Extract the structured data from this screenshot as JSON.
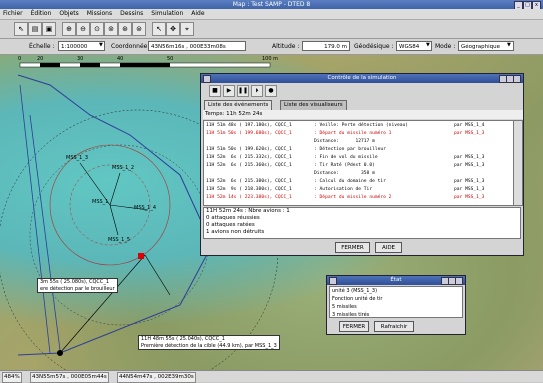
{
  "window": {
    "title": "Map : Test SAMP - DTED 8"
  },
  "menu": [
    "Fichier",
    "Édition",
    "Objets",
    "Missions",
    "Dessins",
    "Simulation",
    "Aide"
  ],
  "fields": {
    "echelle_label": "Échelle :",
    "echelle_value": "1:100000",
    "coord_label": "Coordonnée :",
    "coord_value": "43N56m16s , 000E33m08s",
    "altitude_label": "Altitude :",
    "altitude_value": "179.0 m",
    "geodesique_label": "Géodésique :",
    "geodesique_value": "WGS84",
    "mode_label": "Mode :",
    "mode_value": "Géographique"
  },
  "scale": {
    "ticks": [
      "0",
      "20",
      "30",
      "40",
      "50"
    ],
    "end_label": "100 m"
  },
  "control": {
    "title": "Contrôle de la simulation",
    "tabs": [
      "Liste des événements",
      "Liste des visualiseurs"
    ],
    "time": "Temps: 11h 52m 24s",
    "log": [
      {
        "t": "11H 51m 48s ( 197.180s), CQCC_1",
        "msg": ": Veille: Perte détection (niveau)",
        "who": "par MSS_1_4",
        "red": false
      },
      {
        "t": "11H 51m 50s ( 199.680s), CQCC_1",
        "msg": ": Départ du missile numéro 1",
        "who": "par MSS_1_3",
        "red": true
      },
      {
        "t": "",
        "msg": "Distance:      12717 m",
        "who": "",
        "red": false
      },
      {
        "t": "11H 51m 50s ( 199.620s), CQCC_1",
        "msg": ": Détection par brouilleur",
        "who": "",
        "red": false
      },
      {
        "t": "11H 52m  6s ( 215.332s), CQCC_1",
        "msg": ": Fin de vol du missile",
        "who": "par MSS_1_3",
        "red": false
      },
      {
        "t": "11H 52m  6s ( 215.360s), CQCC_1",
        "msg": ": Tir Raté (Pdest 0.0)",
        "who": "par MSS_1_3",
        "red": false
      },
      {
        "t": "",
        "msg": "Distance:        358 m",
        "who": "",
        "red": false
      },
      {
        "t": "11H 52m  6s ( 215.380s), CQCC_1",
        "msg": ": Calcul du domaine de tir",
        "who": "par MSS_1_3",
        "red": false
      },
      {
        "t": "11H 52m  9s ( 218.380s), CQCC_1",
        "msg": ": Autorisation de Tir",
        "who": "par MSS_1_3",
        "red": false
      },
      {
        "t": "11H 52m 14s ( 223.380s), CQCC_1",
        "msg": ": Départ du missile numéro 2",
        "who": "par MSS_1_3",
        "red": true
      }
    ],
    "summary": [
      "11H 52m 24s : Nbre avions : 1",
      "0 attaques réussies",
      "0 attaques ratées",
      "1 avions non détruits"
    ],
    "btn_close": "FERMER",
    "btn_help": "AIDE"
  },
  "etat": {
    "title": "État",
    "lines": [
      "unité 3 (MSS_1_3)",
      "Fonction unité de tir",
      " 5 missiles",
      " 3 missiles tirés"
    ],
    "btn_close": "FERMER",
    "btn_refresh": "Rafraichir"
  },
  "map_labels": {
    "left_tip": "3m 55s ( 25.080s), CQCC_1\nere détection par le brouilleur",
    "bottom_tip": "11H 48m 55s ( 25.040s), CQCC_1\nPremière détection de la cible (44.9 km), par MSS_1_3",
    "units": [
      "MSS_1_3",
      "MSS_1_2",
      "MSS_1",
      "MSS_1_4",
      "MSS_1_5"
    ]
  },
  "status": {
    "zoom": "484%",
    "coord1": "43N55m57s , 000E05m44s",
    "coord2": "44N54m47s , 002E39m30s"
  }
}
